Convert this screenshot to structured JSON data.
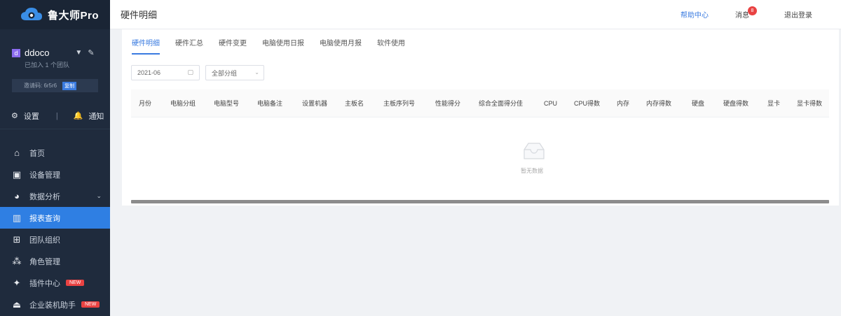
{
  "app": {
    "name": "鲁大师Pro"
  },
  "user": {
    "avatar_letter": "d",
    "name": "ddoco",
    "subtitle": "已加入 1 个团队",
    "code_label": "邀请码: 6r5r6",
    "code_tag": "复制"
  },
  "quick": {
    "settings_label": "设置",
    "notify_label": "通知"
  },
  "menu": [
    {
      "label": "首页",
      "icon": "home-icon"
    },
    {
      "label": "设备管理",
      "icon": "devices-icon"
    },
    {
      "label": "数据分析",
      "icon": "pie-icon",
      "expandable": true
    },
    {
      "label": "报表查询",
      "icon": "report-icon",
      "active": true
    },
    {
      "label": "团队组织",
      "icon": "org-icon"
    },
    {
      "label": "角色管理",
      "icon": "roles-icon"
    },
    {
      "label": "插件中心",
      "icon": "plugin-icon",
      "badge": "NEW"
    },
    {
      "label": "企业装机助手",
      "icon": "assist-icon",
      "badge": "NEW"
    }
  ],
  "header": {
    "title": "硬件明细",
    "link": "帮助中心",
    "messages": "消息",
    "message_count": "8",
    "exit": "退出登录"
  },
  "tabs": [
    "硬件明细",
    "硬件汇总",
    "硬件变更",
    "电脑使用日报",
    "电脑使用月报",
    "软件使用"
  ],
  "filters": {
    "date": "2021-06",
    "category": "全部分组"
  },
  "table": {
    "columns": [
      "月份",
      "电脑分组",
      "电脑型号",
      "电脑备注",
      "设置机器",
      "主板名",
      "主板序列号",
      "性能得分",
      "综合全面得分佳",
      "CPU",
      "CPU得数",
      "内存",
      "内存得数",
      "硬盘",
      "硬盘得数",
      "显卡",
      "显卡得数"
    ],
    "empty_text": "暂无数据"
  }
}
